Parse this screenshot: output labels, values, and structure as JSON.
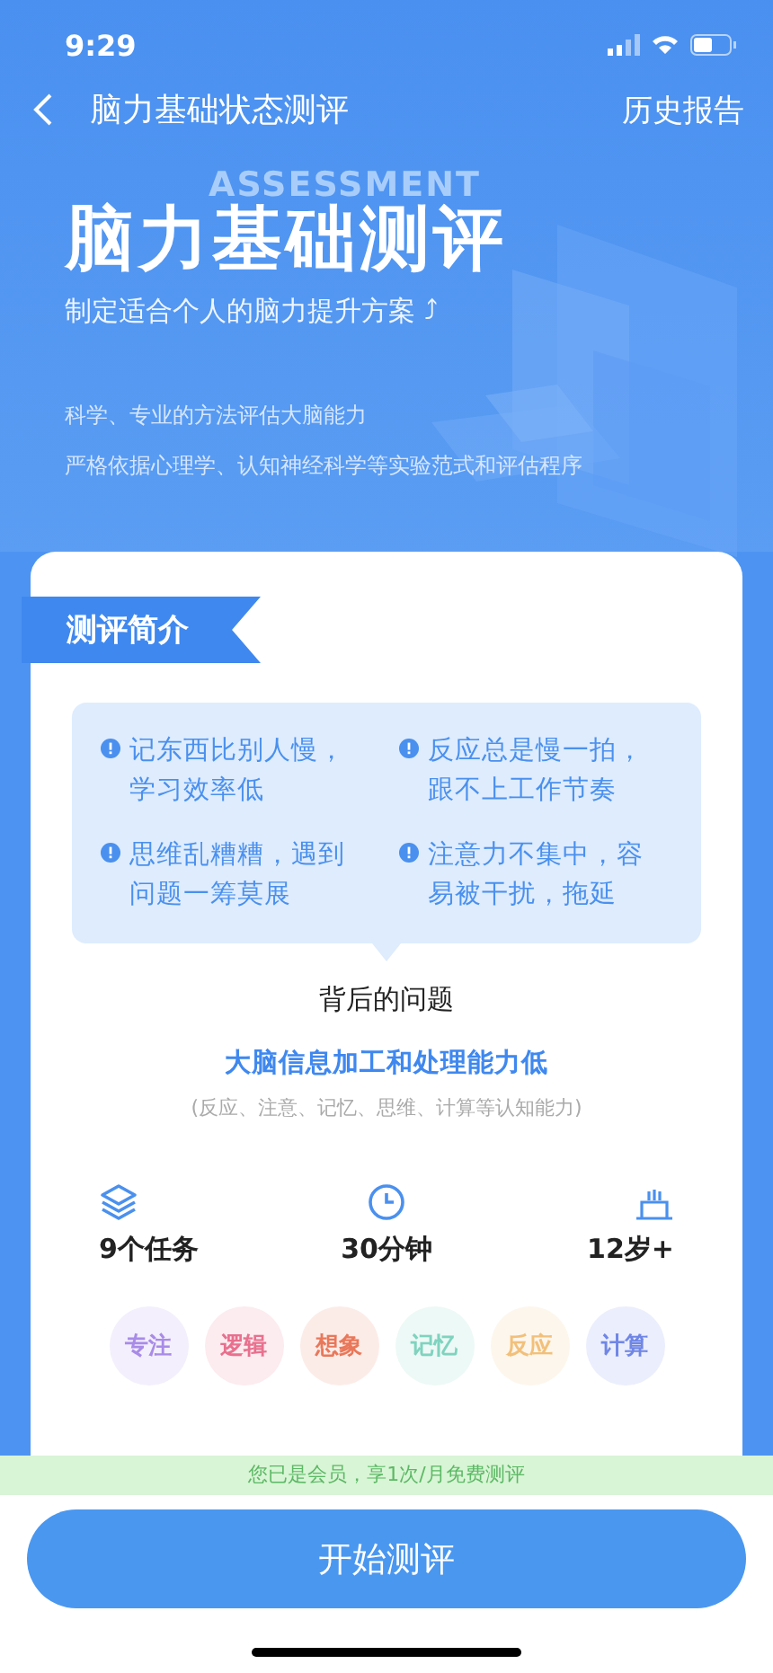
{
  "status_bar": {
    "time": "9:29"
  },
  "nav": {
    "title": "脑力基础状态测评",
    "action": "历史报告"
  },
  "hero": {
    "watermark": "ASSESSMENT",
    "title": "脑力基础测评",
    "subtitle": "制定适合个人的脑力提升方案 ⤴",
    "lines": [
      "科学、专业的方法评估大脑能力",
      "严格依据心理学、认知神经科学等实验范式和评估程序"
    ]
  },
  "card": {
    "ribbon": "测评简介",
    "symptoms": [
      "记东西比别人慢，学习效率低",
      "反应总是慢一拍，跟不上工作节奏",
      "思维乱糟糟，遇到问题一筹莫展",
      "注意力不集中，容易被干扰，拖延"
    ],
    "question_heading": "背后的问题",
    "question": "大脑信息加工和处理能力低",
    "question_note": "(反应、注意、记忆、思维、计算等认知能力)",
    "stats": [
      {
        "kind": "layers",
        "label": "9个任务"
      },
      {
        "kind": "clock",
        "label": "30分钟"
      },
      {
        "kind": "cake",
        "label": "12岁+"
      }
    ],
    "tags": [
      {
        "label": "专注",
        "color": "#a98be8"
      },
      {
        "label": "逻辑",
        "color": "#e8708e"
      },
      {
        "label": "想象",
        "color": "#e9785a"
      },
      {
        "label": "记忆",
        "color": "#7fd3bf"
      },
      {
        "label": "反应",
        "color": "#f2c07a"
      },
      {
        "label": "计算",
        "color": "#6f86e6"
      }
    ]
  },
  "member_banner": "您已是会员，享1次/月免费测评",
  "start_button": "开始测评"
}
